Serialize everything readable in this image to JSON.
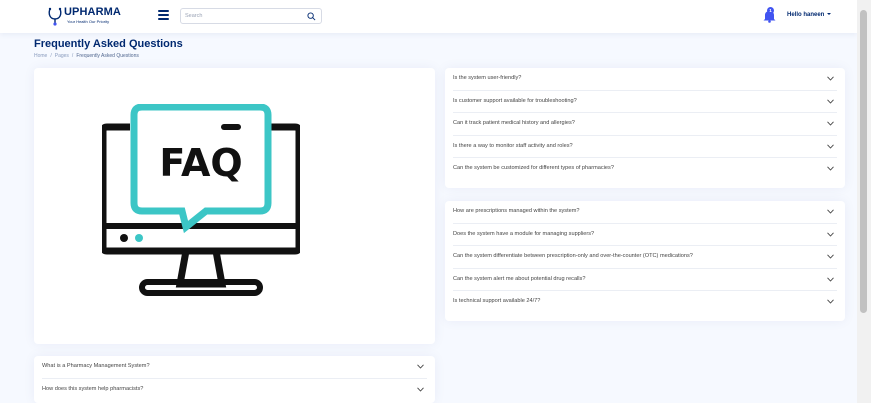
{
  "header": {
    "logo_text": "UPHARMA",
    "logo_tagline": "Your Health Our Priority",
    "search_placeholder": "Search",
    "notification_count": "1",
    "user_greeting": "Hello haneen"
  },
  "page": {
    "title": "Frequently Asked Questions",
    "breadcrumb": [
      "Home",
      "Pages",
      "Frequently Asked Questions"
    ]
  },
  "faq_group_1": [
    "Is the system user-friendly?",
    "Is customer support available for troubleshooting?",
    "Can it track patient medical history and allergies?",
    "Is there a way to monitor staff activity and roles?",
    "Can the system be customized for different types of pharmacies?"
  ],
  "faq_group_2": [
    "How are prescriptions managed within the system?",
    "Does the system have a module for managing suppliers?",
    "Can the system differentiate between prescription-only and over-the-counter (OTC) medications?",
    "Can the system alert me about potential drug recalls?",
    "Is technical support available 24/7?"
  ],
  "faq_group_3": [
    "What is a Pharmacy Management System?",
    "How does this system help pharmacists?"
  ],
  "illustration": {
    "text": "FAQ",
    "colors": {
      "dark": "#111111",
      "accent": "#3cc6c6"
    }
  },
  "colors": {
    "primary": "#012970",
    "accent": "#4154f1",
    "background": "#f6f9ff"
  }
}
